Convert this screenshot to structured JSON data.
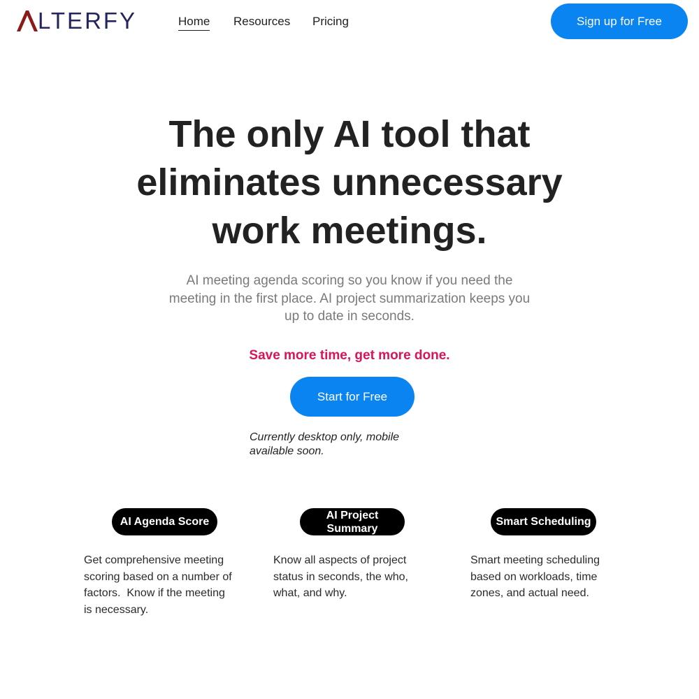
{
  "header": {
    "logo_text": "LTERFY",
    "logo_name": "ALTERFY",
    "nav": [
      {
        "label": "Home",
        "active": true
      },
      {
        "label": "Resources",
        "active": false
      },
      {
        "label": "Pricing",
        "active": false
      }
    ],
    "signup_label": "Sign up for Free"
  },
  "hero": {
    "title_lines": [
      "The only AI tool that",
      "eliminates unnecessary",
      "work meetings."
    ],
    "subtitle_lines": [
      "AI meeting agenda scoring so you know if you need the",
      "meeting in the first place. AI project summarization keeps you",
      "up to date in seconds."
    ],
    "tagline": "Save more time, get more done.",
    "cta_label": "Start for Free",
    "note_lines": [
      "Currently desktop only, mobile",
      "available soon."
    ]
  },
  "features": [
    {
      "title_lines": [
        "AI Agenda Score"
      ],
      "desc_lines": [
        "Get comprehensive meeting",
        "scoring based on a number of",
        "factors.  Know if the meeting",
        "is necessary."
      ]
    },
    {
      "title_lines": [
        "AI Project",
        "Summary"
      ],
      "desc_lines": [
        "Know all aspects of project",
        "status in seconds, the who,",
        "what, and why."
      ]
    },
    {
      "title_lines": [
        "Smart Scheduling"
      ],
      "desc_lines": [
        "Smart meeting scheduling",
        "based on workloads, time",
        "zones, and actual need."
      ]
    }
  ],
  "colors": {
    "accent": "#0a84f0",
    "tagline": "#d6155a",
    "logo_a": "#8b1a1a",
    "logo_text": "#23255e",
    "pill": "#000000"
  }
}
